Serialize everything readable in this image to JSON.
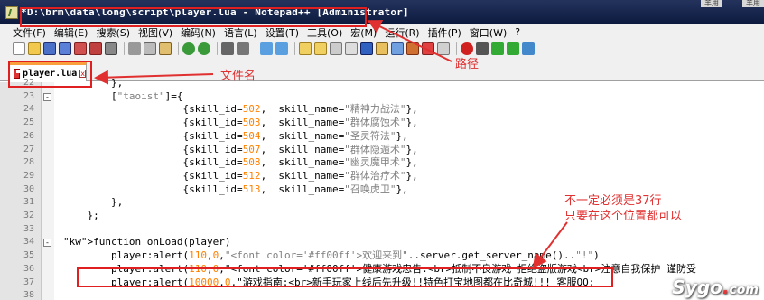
{
  "window": {
    "title": "*D:\\brm\\data\\long\\script\\player.lua - Notepad++ [Administrator]",
    "background_tabs": [
      "羊用",
      "羊用"
    ]
  },
  "menu": [
    "文件(F)",
    "编辑(E)",
    "搜索(S)",
    "视图(V)",
    "编码(N)",
    "语言(L)",
    "设置(T)",
    "工具(O)",
    "宏(M)",
    "运行(R)",
    "插件(P)",
    "窗口(W)",
    "?"
  ],
  "tab": {
    "label": "player.lua",
    "close": "x"
  },
  "lines": [
    {
      "n": "22",
      "code": "        },"
    },
    {
      "n": "23",
      "code": "        [\"taoist\"]={"
    },
    {
      "n": "24",
      "code": "                    {skill_id=502,  skill_name=\"精神力战法\"},"
    },
    {
      "n": "25",
      "code": "                    {skill_id=503,  skill_name=\"群体腐蚀术\"},"
    },
    {
      "n": "26",
      "code": "                    {skill_id=504,  skill_name=\"圣灵符法\"},"
    },
    {
      "n": "27",
      "code": "                    {skill_id=507,  skill_name=\"群体隐遁术\"},"
    },
    {
      "n": "28",
      "code": "                    {skill_id=508,  skill_name=\"幽灵魔甲术\"},"
    },
    {
      "n": "29",
      "code": "                    {skill_id=512,  skill_name=\"群体治疗术\"},"
    },
    {
      "n": "30",
      "code": "                    {skill_id=513,  skill_name=\"召唤虎卫\"},"
    },
    {
      "n": "31",
      "code": "        },"
    },
    {
      "n": "32",
      "code": "    };"
    },
    {
      "n": "33",
      "code": ""
    },
    {
      "n": "34",
      "code": "function onLoad(player)"
    },
    {
      "n": "35",
      "code": "        player:alert(110,0,\"<font color='#ff00ff'>欢迎来到\"..server.get_server_name()..\"!\")"
    },
    {
      "n": "36",
      "code": "        player:alert(110,0,\"<font color='#ff00ff'>健康游戏忠告:<br>抵制不良游戏 拒绝盗版游戏<br>注意自我保护 谨防受"
    },
    {
      "n": "37",
      "code": "        player:alert(10000,0,\"游戏指南:<br>新手玩家上线后先升级!!特色打宝地图都在比奇城!!! 客服QQ:"
    },
    {
      "n": "38",
      "code": ""
    }
  ],
  "annotations": {
    "path": "路径",
    "filename": "文件名",
    "note_line1": "不一定必须是37行",
    "note_line2": "只要在这个位置都可以"
  },
  "watermark": {
    "main": "Sygo",
    "dot": ".",
    "tld": "com"
  },
  "colors": {
    "annotation": "#e03030",
    "keyword": "#0000ff",
    "string": "#808080",
    "number": "#ff8000",
    "tab_accent": "#f9a03c"
  }
}
